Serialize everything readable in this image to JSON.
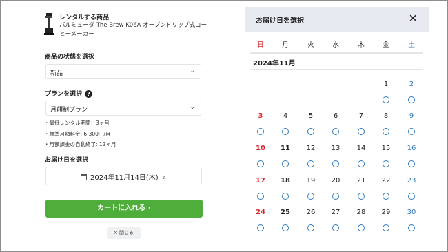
{
  "product": {
    "title": "レンタルする商品",
    "name": "バルミューダ The Brew K06A オープンドリップ式コーヒーメーカー"
  },
  "condition": {
    "label": "商品の状態を選択",
    "value": "新品"
  },
  "plan": {
    "label": "プランを選択",
    "help_icon": "?",
    "value": "月額制プラン",
    "details": [
      "・最低レンタル期間：3ヶ月",
      "・標準月額料金: 6,300円/月",
      "・月額課金の自動終了: 12ヶ月"
    ]
  },
  "delivery": {
    "label": "お届け日を選択",
    "value": "2024年11月14日(木)"
  },
  "cart_button": "カートに入れる ›",
  "close_button": "× 閉じる",
  "calendar": {
    "title": "お届け日を選択",
    "close_icon": "✕",
    "month": "2024年11月",
    "weekdays": [
      "日",
      "月",
      "火",
      "水",
      "木",
      "金",
      "土"
    ],
    "available_mark": "○",
    "weeks": [
      [
        null,
        null,
        null,
        null,
        null,
        "1",
        "2"
      ],
      [
        "3",
        "4",
        "5",
        "6",
        "7",
        "8",
        "9"
      ],
      [
        "10",
        "11",
        "12",
        "13",
        "14",
        "15",
        "16"
      ],
      [
        "17",
        "18",
        "19",
        "20",
        "21",
        "22",
        "23"
      ],
      [
        "24",
        "25",
        "26",
        "27",
        "28",
        "29",
        "30"
      ]
    ],
    "available": [
      [
        false,
        false,
        false,
        false,
        false,
        true,
        true
      ],
      [
        true,
        true,
        true,
        true,
        true,
        true,
        true
      ],
      [
        true,
        true,
        true,
        true,
        true,
        true,
        true
      ],
      [
        true,
        true,
        true,
        true,
        true,
        true,
        true
      ],
      [
        true,
        true,
        true,
        true,
        true,
        true,
        true
      ]
    ],
    "colors": {
      "sunday": "#d0252a",
      "saturday": "#2f79bc",
      "available": "#2f79bc"
    }
  }
}
